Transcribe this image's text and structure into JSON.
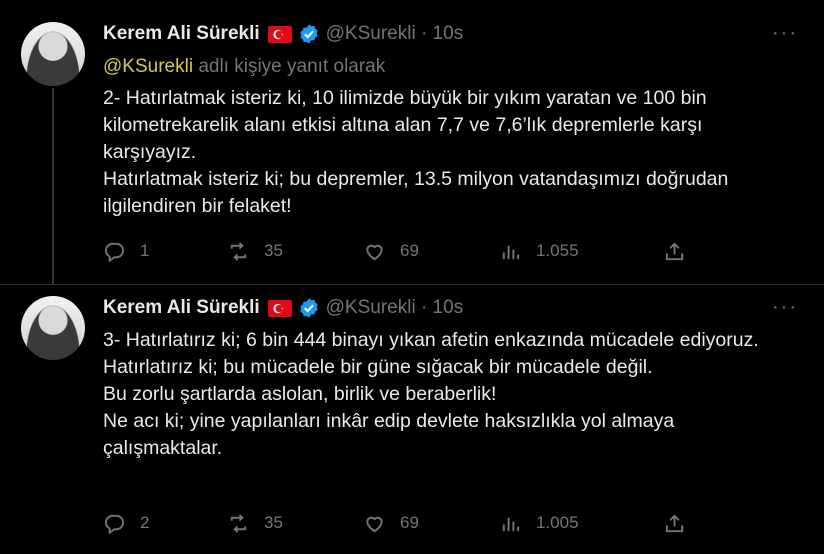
{
  "tweets": [
    {
      "author": "Kerem Ali Sürekli",
      "handle": "@KSurekli · 10s",
      "reply_mention": "@KSurekli",
      "reply_text": "adlı kişiye yanıt olarak",
      "text": [
        "2- Hatırlatmak isteriz ki, 10 ilimizde büyük bir yıkım yaratan ve 100 bin kilometrekarelik alanı etkisi altına alan 7,7 ve 7,6’lık depremlerle karşı karşıyayız.",
        "Hatırlatmak isteriz ki; bu depremler, 13.5 milyon vatandaşımızı doğrudan ilgilendiren bir felaket!"
      ],
      "replies": "1",
      "retweets": "35",
      "likes": "69",
      "views": "1.055"
    },
    {
      "author": "Kerem Ali Sürekli",
      "handle": "@KSurekli · 10s",
      "text": [
        "3- Hatırlatırız ki; 6 bin 444 binayı yıkan afetin enkazında mücadele ediyoruz.",
        "Hatırlatırız ki; bu mücadele bir güne sığacak bir mücadele değil.",
        "Bu zorlu şartlarda aslolan, birlik ve beraberlik!",
        "Ne acı ki; yine yapılanları inkâr edip devlete haksızlıkla yol almaya çalışmaktalar."
      ],
      "replies": "2",
      "retweets": "35",
      "likes": "69",
      "views": "1.005"
    }
  ],
  "more_glyph": "···",
  "colors": {
    "background": "#000000",
    "text": "#e7e9ea",
    "muted": "#71767b",
    "verified": "#1d9bf0",
    "mention": "#d8c84a",
    "flag": "#e30a17"
  }
}
